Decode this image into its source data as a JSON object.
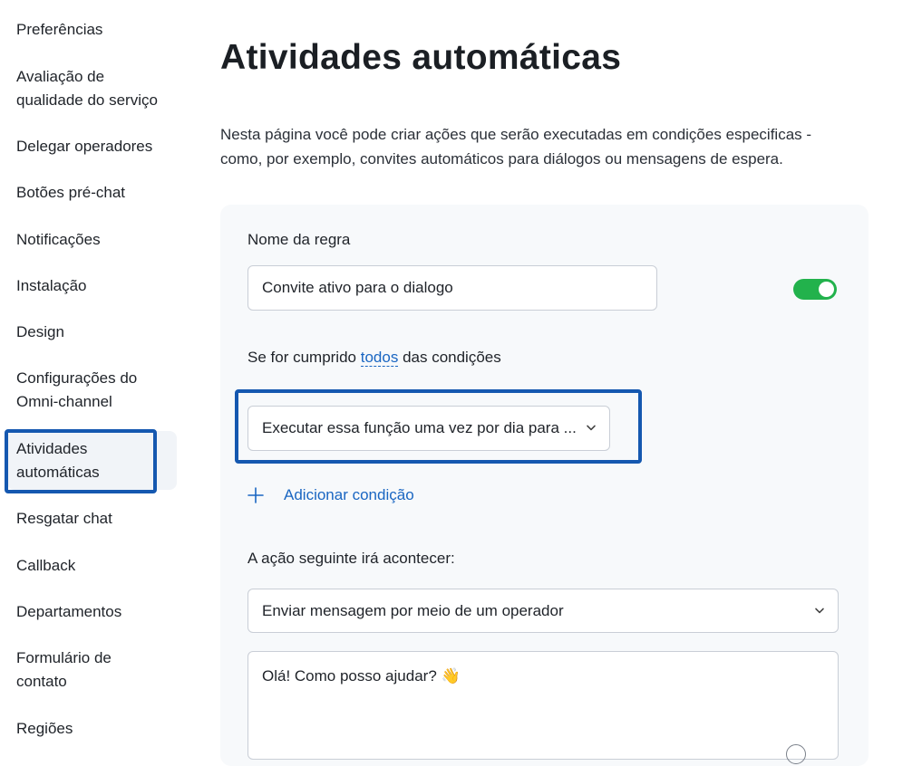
{
  "sidebar": {
    "items": [
      {
        "label": "Preferências"
      },
      {
        "label": "Avaliação de qualidade do serviço"
      },
      {
        "label": "Delegar operadores"
      },
      {
        "label": "Botões pré-chat"
      },
      {
        "label": "Notificações"
      },
      {
        "label": "Instalação"
      },
      {
        "label": "Design"
      },
      {
        "label": "Configurações do Omni-channel"
      },
      {
        "label": "Atividades automáticas",
        "active": true
      },
      {
        "label": "Resgatar chat"
      },
      {
        "label": "Callback"
      },
      {
        "label": "Departamentos"
      },
      {
        "label": "Formulário de contato"
      },
      {
        "label": "Regiões"
      }
    ]
  },
  "main": {
    "title": "Atividades automáticas",
    "description": "Nesta página você pode criar ações que serão executadas em condições especificas - como, por exemplo, convites automáticos para diálogos ou mensagens de espera.",
    "rule": {
      "name_label": "Nome da regra",
      "name_value": "Convite ativo para o dialogo",
      "enabled": true,
      "condition_prefix": "Se for cumprido",
      "condition_mode": "todos",
      "condition_suffix": "das condições",
      "condition_value": "Executar essa função uma vez por dia para ...",
      "add_condition_label": "Adicionar condição",
      "action_label": "A ação seguinte irá acontecer:",
      "action_value": "Enviar mensagem por meio de um operador",
      "message_value": "Olá! Como posso ajudar? 👋"
    }
  },
  "colors": {
    "accent": "#1a66c2",
    "toggle_on": "#22b24c",
    "highlight_border": "#1558b0"
  }
}
